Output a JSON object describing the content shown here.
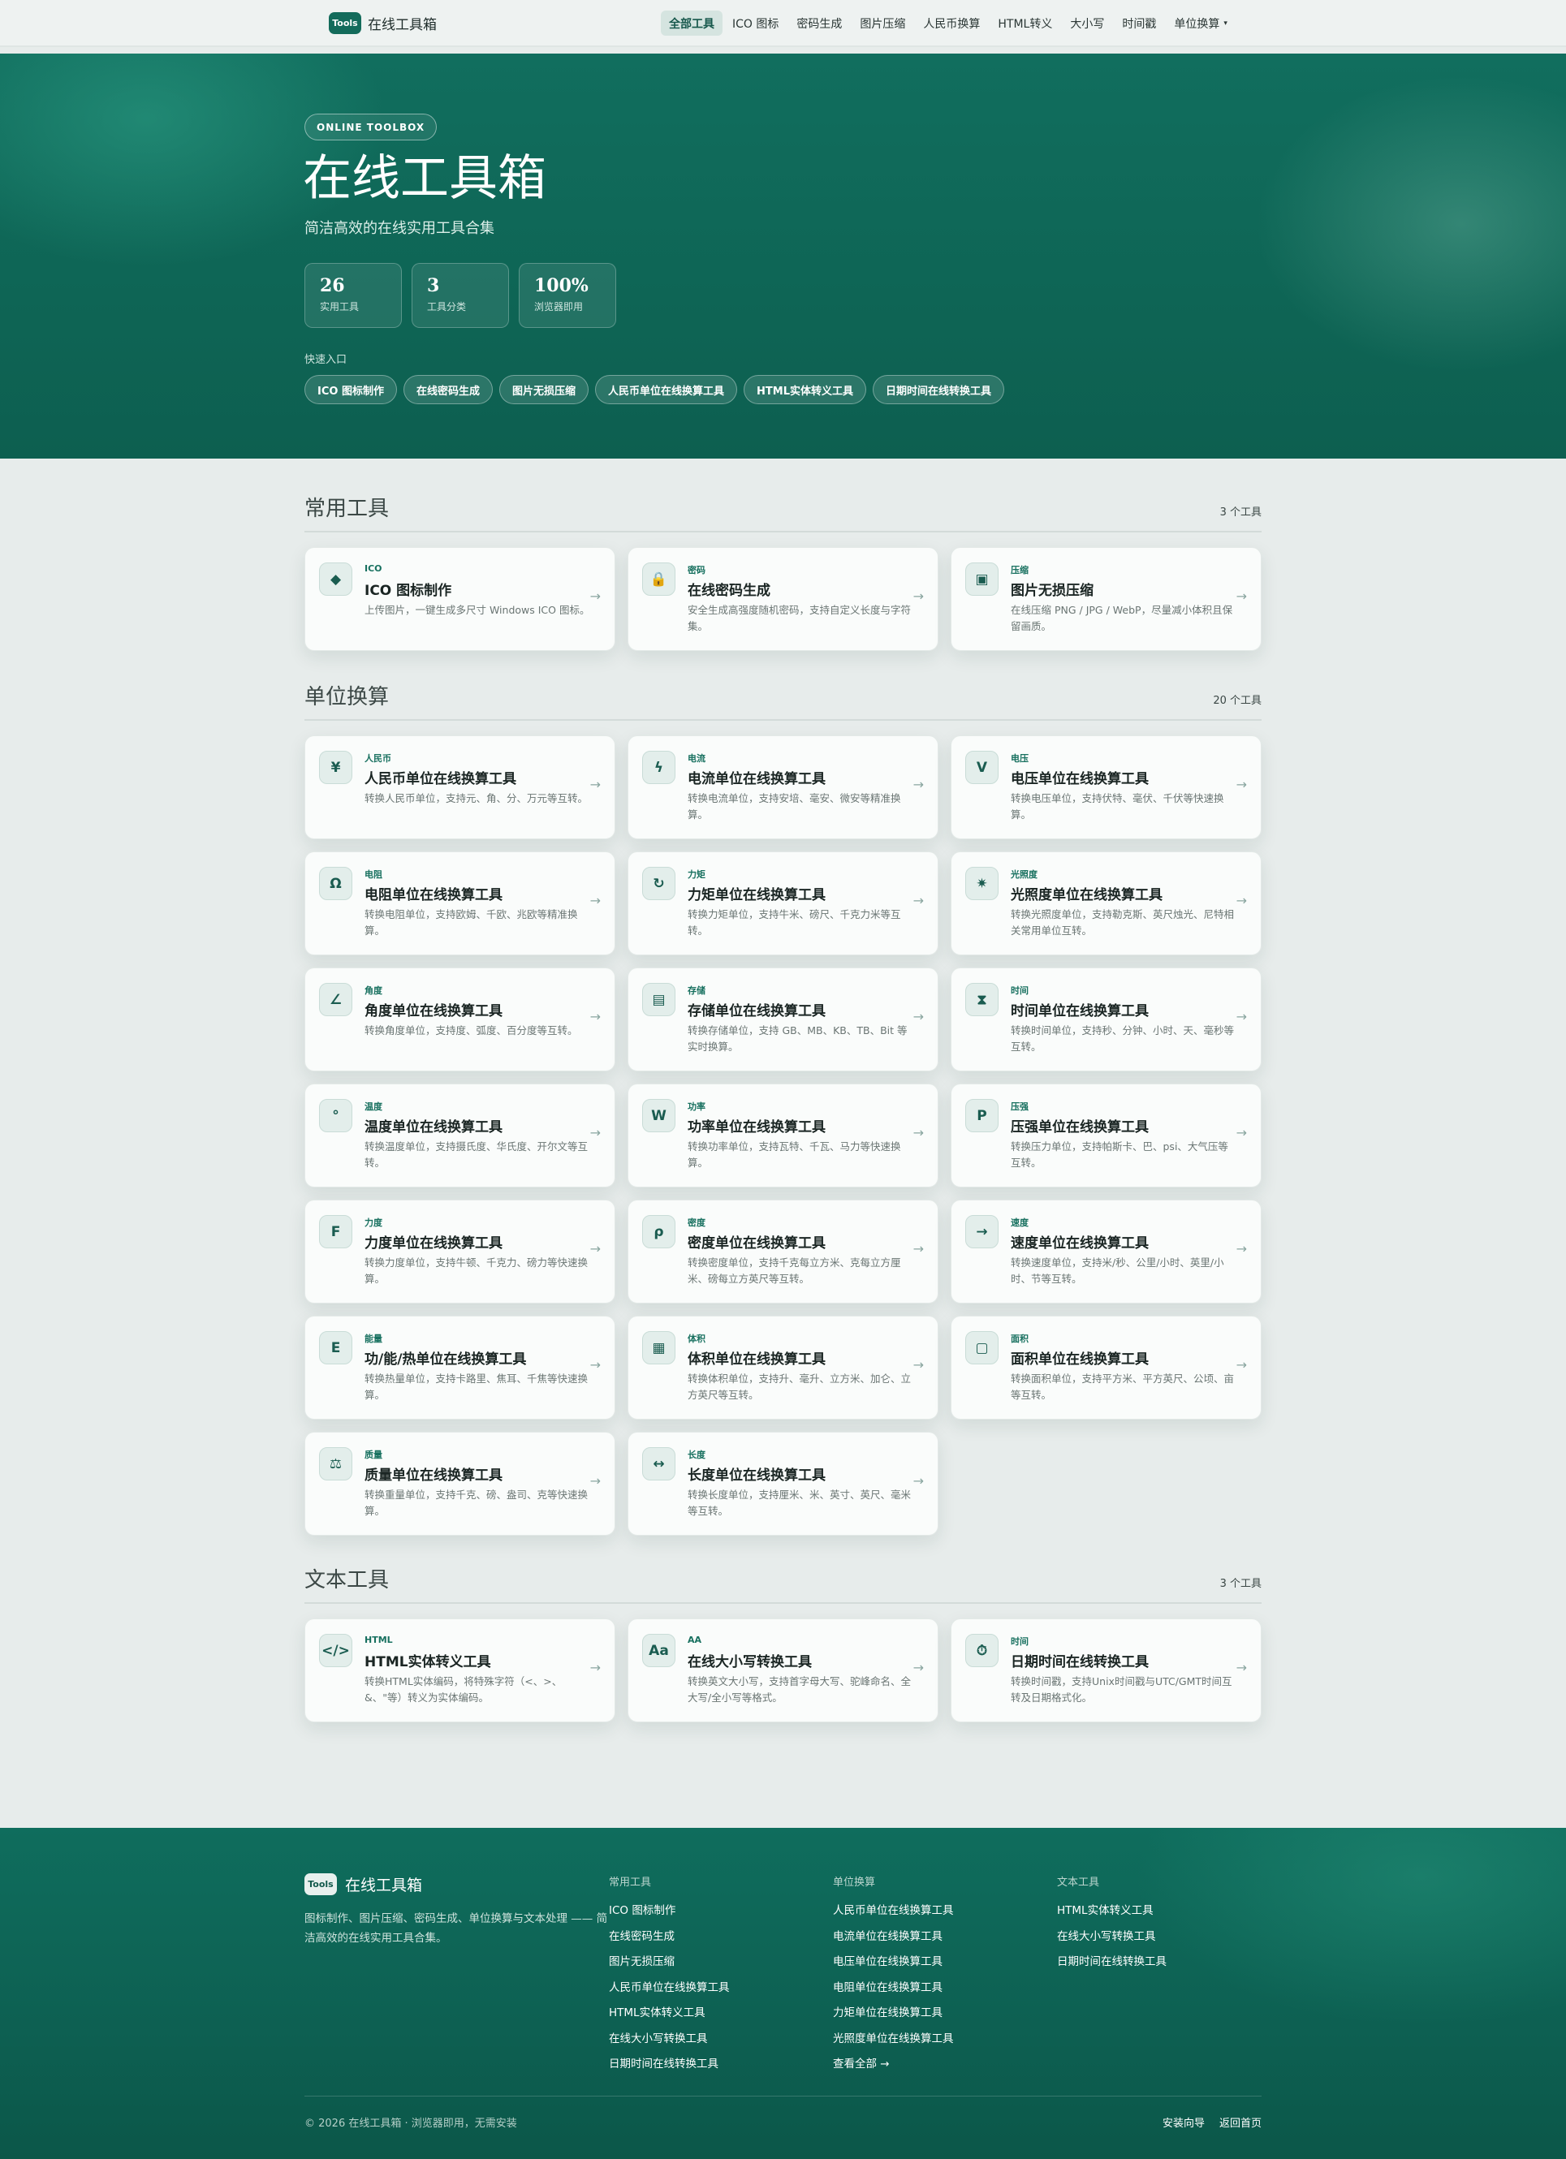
{
  "nav": {
    "brand_badge": "Tools",
    "brand_name": "在线工具箱",
    "links": [
      {
        "label": "全部工具",
        "active": true
      },
      {
        "label": "ICO 图标"
      },
      {
        "label": "密码生成"
      },
      {
        "label": "图片压缩"
      },
      {
        "label": "人民币换算"
      },
      {
        "label": "HTML转义"
      },
      {
        "label": "大小写"
      },
      {
        "label": "时间戳"
      },
      {
        "label": "单位换算",
        "dropdown": true
      }
    ]
  },
  "hero": {
    "eyebrow": "ONLINE TOOLBOX",
    "title": "在线工具箱",
    "subtitle": "简洁高效的在线实用工具合集",
    "stats": [
      {
        "value": "26",
        "label": "实用工具"
      },
      {
        "value": "3",
        "label": "工具分类"
      },
      {
        "value": "100%",
        "label": "浏览器即用"
      }
    ],
    "quick_label": "快速入口",
    "quick_links": [
      "ICO 图标制作",
      "在线密码生成",
      "图片无损压缩",
      "人民币单位在线换算工具",
      "HTML实体转义工具",
      "日期时间在线转换工具"
    ]
  },
  "sections": [
    {
      "title": "常用工具",
      "count": "3 个工具",
      "cards": [
        {
          "icon": "◆",
          "icon_name": "diamond-icon",
          "cat": "ICO",
          "title": "ICO 图标制作",
          "desc": "上传图片，一键生成多尺寸 Windows ICO 图标。"
        },
        {
          "icon": "🔒",
          "icon_name": "lock-icon",
          "cat": "密码",
          "title": "在线密码生成",
          "desc": "安全生成高强度随机密码，支持自定义长度与字符集。"
        },
        {
          "icon": "▣",
          "icon_name": "image-icon",
          "cat": "压缩",
          "title": "图片无损压缩",
          "desc": "在线压缩 PNG / JPG / WebP，尽量减小体积且保留画质。"
        }
      ]
    },
    {
      "title": "单位换算",
      "count": "20 个工具",
      "cards": [
        {
          "icon": "¥",
          "icon_name": "yuan-icon",
          "cat": "人民币",
          "title": "人民币单位在线换算工具",
          "desc": "转换人民币单位，支持元、角、分、万元等互转。"
        },
        {
          "icon": "ϟ",
          "icon_name": "lightning-icon",
          "cat": "电流",
          "title": "电流单位在线换算工具",
          "desc": "转换电流单位，支持安培、毫安、微安等精准换算。"
        },
        {
          "icon": "V",
          "icon_name": "volt-icon",
          "cat": "电压",
          "title": "电压单位在线换算工具",
          "desc": "转换电压单位，支持伏特、毫伏、千伏等快速换算。"
        },
        {
          "icon": "Ω",
          "icon_name": "ohm-icon",
          "cat": "电阻",
          "title": "电阻单位在线换算工具",
          "desc": "转换电阻单位，支持欧姆、千欧、兆欧等精准换算。"
        },
        {
          "icon": "↻",
          "icon_name": "rotate-icon",
          "cat": "力矩",
          "title": "力矩单位在线换算工具",
          "desc": "转换力矩单位，支持牛米、磅尺、千克力米等互转。"
        },
        {
          "icon": "✷",
          "icon_name": "sun-icon",
          "cat": "光照度",
          "title": "光照度单位在线换算工具",
          "desc": "转换光照度单位，支持勒克斯、英尺烛光、尼特相关常用单位互转。"
        },
        {
          "icon": "∠",
          "icon_name": "angle-icon",
          "cat": "角度",
          "title": "角度单位在线换算工具",
          "desc": "转换角度单位，支持度、弧度、百分度等互转。"
        },
        {
          "icon": "▤",
          "icon_name": "storage-icon",
          "cat": "存储",
          "title": "存储单位在线换算工具",
          "desc": "转换存储单位，支持 GB、MB、KB、TB、Bit 等实时换算。"
        },
        {
          "icon": "⧗",
          "icon_name": "hourglass-icon",
          "cat": "时间",
          "title": "时间单位在线换算工具",
          "desc": "转换时间单位，支持秒、分钟、小时、天、毫秒等互转。"
        },
        {
          "icon": "°",
          "icon_name": "degree-icon",
          "cat": "温度",
          "title": "温度单位在线换算工具",
          "desc": "转换温度单位，支持摄氏度、华氏度、开尔文等互转。"
        },
        {
          "icon": "W",
          "icon_name": "watt-icon",
          "cat": "功率",
          "title": "功率单位在线换算工具",
          "desc": "转换功率单位，支持瓦特、千瓦、马力等快速换算。"
        },
        {
          "icon": "P",
          "icon_name": "pressure-icon",
          "cat": "压强",
          "title": "压强单位在线换算工具",
          "desc": "转换压力单位，支持帕斯卡、巴、psi、大气压等互转。"
        },
        {
          "icon": "F",
          "icon_name": "force-icon",
          "cat": "力度",
          "title": "力度单位在线换算工具",
          "desc": "转换力度单位，支持牛顿、千克力、磅力等快速换算。"
        },
        {
          "icon": "ρ",
          "icon_name": "rho-icon",
          "cat": "密度",
          "title": "密度单位在线换算工具",
          "desc": "转换密度单位，支持千克每立方米、克每立方厘米、磅每立方英尺等互转。"
        },
        {
          "icon": "→",
          "icon_name": "arrow-right-icon",
          "cat": "速度",
          "title": "速度单位在线换算工具",
          "desc": "转换速度单位，支持米/秒、公里/小时、英里/小时、节等互转。"
        },
        {
          "icon": "E",
          "icon_name": "energy-icon",
          "cat": "能量",
          "title": "功/能/热单位在线换算工具",
          "desc": "转换热量单位，支持卡路里、焦耳、千焦等快速换算。"
        },
        {
          "icon": "▦",
          "icon_name": "cube-icon",
          "cat": "体积",
          "title": "体积单位在线换算工具",
          "desc": "转换体积单位，支持升、毫升、立方米、加仑、立方英尺等互转。"
        },
        {
          "icon": "▢",
          "icon_name": "square-icon",
          "cat": "面积",
          "title": "面积单位在线换算工具",
          "desc": "转换面积单位，支持平方米、平方英尺、公顷、亩等互转。"
        },
        {
          "icon": "⚖",
          "icon_name": "scale-icon",
          "cat": "质量",
          "title": "质量单位在线换算工具",
          "desc": "转换重量单位，支持千克、磅、盎司、克等快速换算。"
        },
        {
          "icon": "↔",
          "icon_name": "ruler-icon",
          "cat": "长度",
          "title": "长度单位在线换算工具",
          "desc": "转换长度单位，支持厘米、米、英寸、英尺、毫米等互转。"
        }
      ]
    },
    {
      "title": "文本工具",
      "count": "3 个工具",
      "cards": [
        {
          "icon": "</>",
          "icon_name": "code-icon",
          "cat": "HTML",
          "title": "HTML实体转义工具",
          "desc": "转换HTML实体编码，将特殊字符（<、>、&、\"等）转义为实体编码。"
        },
        {
          "icon": "Aa",
          "icon_name": "text-case-icon",
          "cat": "AA",
          "title": "在线大小写转换工具",
          "desc": "转换英文大小写，支持首字母大写、驼峰命名、全大写/全小写等格式。"
        },
        {
          "icon": "⏱",
          "icon_name": "stopwatch-icon",
          "cat": "时间",
          "title": "日期时间在线转换工具",
          "desc": "转换时间戳，支持Unix时间戳与UTC/GMT时间互转及日期格式化。"
        }
      ]
    }
  ],
  "footer": {
    "brand_badge": "Tools",
    "brand_name": "在线工具箱",
    "desc": "图标制作、图片压缩、密码生成、单位换算与文本处理 —— 简洁高效的在线实用工具合集。",
    "columns": [
      {
        "title": "常用工具",
        "links": [
          "ICO 图标制作",
          "在线密码生成",
          "图片无损压缩",
          "人民币单位在线换算工具",
          "HTML实体转义工具",
          "在线大小写转换工具",
          "日期时间在线转换工具"
        ]
      },
      {
        "title": "单位换算",
        "links": [
          "人民币单位在线换算工具",
          "电流单位在线换算工具",
          "电压单位在线换算工具",
          "电阻单位在线换算工具",
          "力矩单位在线换算工具",
          "光照度单位在线换算工具",
          "查看全部 →"
        ]
      },
      {
        "title": "文本工具",
        "links": [
          "HTML实体转义工具",
          "在线大小写转换工具",
          "日期时间在线转换工具"
        ]
      }
    ],
    "copyright": "© 2026 在线工具箱 · 浏览器即用，无需安装",
    "bottom_links": [
      "安装向导",
      "返回首页"
    ]
  }
}
